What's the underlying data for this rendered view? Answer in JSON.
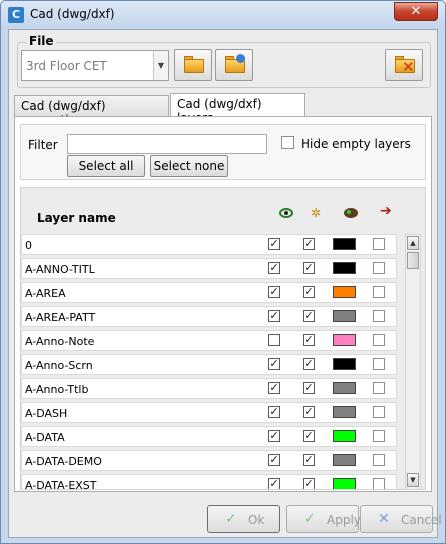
{
  "window": {
    "title": "Cad (dwg/dxf)",
    "icon": "cad-app-icon",
    "close_glyph": "✕"
  },
  "file": {
    "legend": "File",
    "selected": "3rd Floor CET",
    "combo_arrow_glyph": "▼",
    "open_icon": "open-folder-icon",
    "recent_icon": "reload-folder-icon",
    "remove_icon": "delete-file-icon"
  },
  "tabs": [
    {
      "label": "Cad (dwg/dxf) properties",
      "active": false
    },
    {
      "label": "Cad (dwg/dxf) layers",
      "active": true
    }
  ],
  "filter": {
    "label": "Filter",
    "value": "",
    "hide_empty_label": "Hide empty layers",
    "hide_empty_checked": false,
    "select_all": "Select all",
    "select_none": "Select none"
  },
  "layers": {
    "header_name": "Layer name",
    "header_icons": [
      "visible-eye-icon",
      "freeze-sun-icon",
      "color-palette-icon",
      "plot-arrow-icon"
    ],
    "check_glyph": "✓",
    "rows": [
      {
        "name": "0",
        "visible": true,
        "frozen": true,
        "color": "#000000",
        "plot": false
      },
      {
        "name": "A-ANNO-TITL",
        "visible": true,
        "frozen": true,
        "color": "#000000",
        "plot": false
      },
      {
        "name": "A-AREA",
        "visible": true,
        "frozen": true,
        "color": "#ff8000",
        "plot": false
      },
      {
        "name": "A-AREA-PATT",
        "visible": true,
        "frozen": true,
        "color": "#808080",
        "plot": false
      },
      {
        "name": "A-Anno-Note",
        "visible": false,
        "frozen": true,
        "color": "#ff80c0",
        "plot": false
      },
      {
        "name": "A-Anno-Scrn",
        "visible": true,
        "frozen": true,
        "color": "#000000",
        "plot": false
      },
      {
        "name": "A-Anno-Ttlb",
        "visible": true,
        "frozen": true,
        "color": "#808080",
        "plot": false
      },
      {
        "name": "A-DASH",
        "visible": true,
        "frozen": true,
        "color": "#808080",
        "plot": false
      },
      {
        "name": "A-DATA",
        "visible": true,
        "frozen": true,
        "color": "#00ff00",
        "plot": false
      },
      {
        "name": "A-DATA-DEMO",
        "visible": true,
        "frozen": true,
        "color": "#808080",
        "plot": false
      },
      {
        "name": "A-DATA-EXST",
        "visible": true,
        "frozen": true,
        "color": "#00ff00",
        "plot": false
      }
    ],
    "scroll_up_glyph": "▲",
    "scroll_down_glyph": "▼"
  },
  "actions": {
    "ok": "Ok",
    "apply": "Apply",
    "cancel": "Cancel",
    "ok_glyph": "✓",
    "apply_glyph": "✓",
    "cancel_glyph": "✕",
    "disabled_color": "#9a9a9a",
    "ok_icon_color": "#7fc47f",
    "cancel_icon_color": "#7b9fd6"
  }
}
